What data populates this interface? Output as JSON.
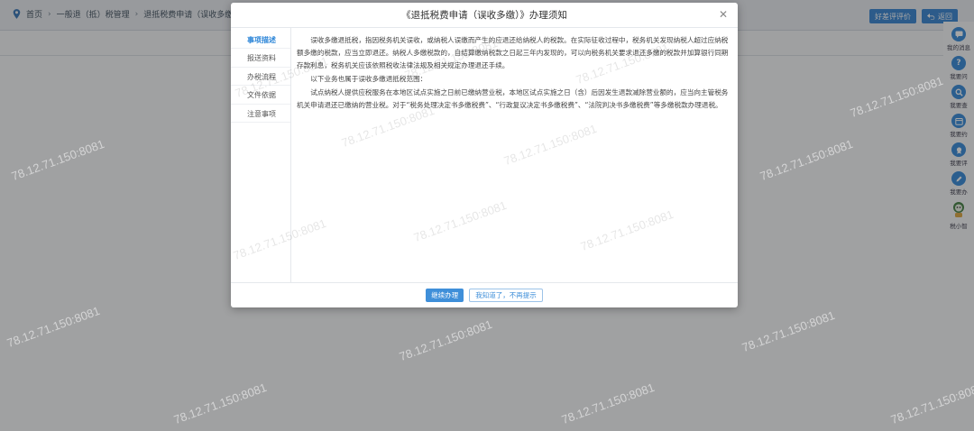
{
  "breadcrumb": {
    "home": "首页",
    "level1": "一般退（抵）税管理",
    "level2": "退抵税费申请（误收多缴）【创"
  },
  "top_actions": {
    "evaluate": "好差评评价",
    "back": "返回"
  },
  "right_rail": [
    {
      "label": "我的消息",
      "icon": "message-icon"
    },
    {
      "label": "我要问",
      "icon": "question-icon"
    },
    {
      "label": "我要查",
      "icon": "search-icon"
    },
    {
      "label": "我要约",
      "icon": "calendar-icon"
    },
    {
      "label": "我要评",
      "icon": "medal-icon"
    },
    {
      "label": "我要办",
      "icon": "pencil-icon"
    },
    {
      "label": "税小智",
      "icon": "robot-icon"
    }
  ],
  "modal": {
    "title": "《退抵税费申请（误收多缴）》办理须知",
    "nav": [
      "事项描述",
      "报送资料",
      "办税流程",
      "文件依据",
      "注意事项"
    ],
    "active_nav": 0,
    "paragraphs": [
      "误收多缴退抵税，指因税务机关误收，或纳税人误缴而产生的应退还给纳税人的税款。在实际征收过程中，税务机关发现纳税人超过应纳税额多缴的税款，应当立即退还。纳税人多缴税款的，自结算缴纳税款之日起三年内发现的，可以向税务机关要求退还多缴的税款并加算银行同期存款利息，税务机关应该依照税收法律法规及相关规定办理退还手续。",
      "以下业务也属于误收多缴退抵税范围：",
      "试点纳税人提供应税服务在本地区试点实施之日前已缴纳营业税，本地区试点实施之日（含）后因发生退款减除营业额的，应当向主管税务机关申请退还已缴纳的营业税。对于“税务处理决定书多缴税费”、“行政复议决定书多缴税费”、“法院判决书多缴税费”等多缴税款办理退税。"
    ],
    "buttons": {
      "continue": "继续办理",
      "dismiss": "我知道了，不再提示"
    }
  },
  "watermark": "78.12.71.150:8081",
  "colors": {
    "accent": "#2d86d8",
    "primary_button": "#3f8fd9"
  }
}
